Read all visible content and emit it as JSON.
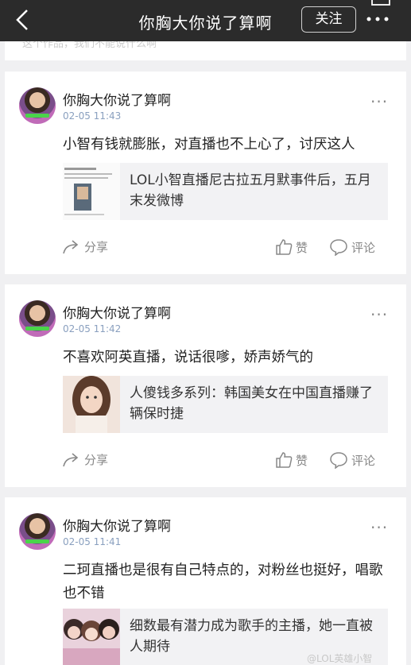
{
  "header": {
    "title": "你胸大你说了算啊",
    "follow_label": "关注"
  },
  "prev_card": {
    "text": "这个作品，我们不能说什么啊"
  },
  "posts": [
    {
      "username": "你胸大你说了算啊",
      "time": "02-05 11:43",
      "content": "小智有钱就膨胀，对直播也不上心了，讨厌这人",
      "link_title": "LOL小智直播尼古拉五月默事件后，五月末发微博",
      "share_label": "分享",
      "like_label": "赞",
      "comment_label": "评论"
    },
    {
      "username": "你胸大你说了算啊",
      "time": "02-05 11:42",
      "content": "不喜欢阿英直播，说话很嗲，娇声娇气的",
      "link_title": "人傻钱多系列：韩国美女在中国直播赚了辆保时捷",
      "share_label": "分享",
      "like_label": "赞",
      "comment_label": "评论"
    },
    {
      "username": "你胸大你说了算啊",
      "time": "02-05 11:41",
      "content": "二珂直播也是很有自己特点的，对粉丝也挺好，唱歌也不错",
      "link_title": "细数最有潜力成为歌手的主播，她一直被人期待"
    }
  ],
  "watermark": "@LOL英雄小智",
  "colors": {
    "header_bg": "#2b2b2b",
    "time_text": "#8aa0bf",
    "page_bg": "#f0f0f2"
  }
}
